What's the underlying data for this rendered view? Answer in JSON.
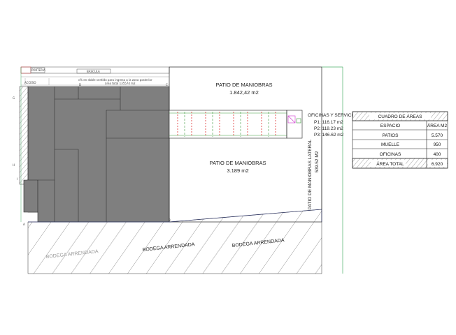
{
  "plan": {
    "top_bar": {
      "porteria": "PORTERIA",
      "bascula": "BASCULA",
      "acceso": "ACCESO",
      "note_line1": "c% en doble sentido para ingreso a la zona posterior",
      "note_line2": "área total 135574 m2"
    },
    "grid_letters": [
      "G",
      "H",
      "I",
      "A",
      "B",
      "D",
      "C"
    ],
    "patio_top": {
      "name": "PATIO DE MANIOBRAS",
      "area": "1.842,42 m2"
    },
    "patio_main": {
      "name": "PATIO DE MANIOBRAS",
      "area": "3.189 m2"
    },
    "oficinas": {
      "title": "OFICINAS Y SERVICIOS",
      "lines": [
        "P1: 116.17 m2",
        "P2: 118.23 m2",
        "P3: 146.62 m2"
      ]
    },
    "patio_lateral": {
      "name": "PATIO DE MANIOBRAS LATERAL",
      "area": "539.52 M2"
    },
    "bodegas": [
      "BODEGA ARRENDADA",
      "BODEGA ARRENDADA",
      "BODEGA ARRENDADA"
    ]
  },
  "areas_table": {
    "title": "CUADRO DE ÁREAS",
    "headers": [
      "ESPACIO",
      "ÁREA M2"
    ],
    "rows": [
      {
        "espacio": "PATIOS",
        "area": "5.570"
      },
      {
        "espacio": "MUELLE",
        "area": "950"
      },
      {
        "espacio": "OFICINAS",
        "area": "400"
      }
    ],
    "total": {
      "espacio": "ÁREA TOTAL",
      "area": "6.920"
    }
  },
  "colors": {
    "building": "#7f7f7f",
    "outline": "#222222",
    "dock_red": "#e03030",
    "dock_green": "#3a9a3a",
    "boundary_green": "#4caf6a",
    "boundary_blue": "#3344aa",
    "hatch": "#555555"
  }
}
